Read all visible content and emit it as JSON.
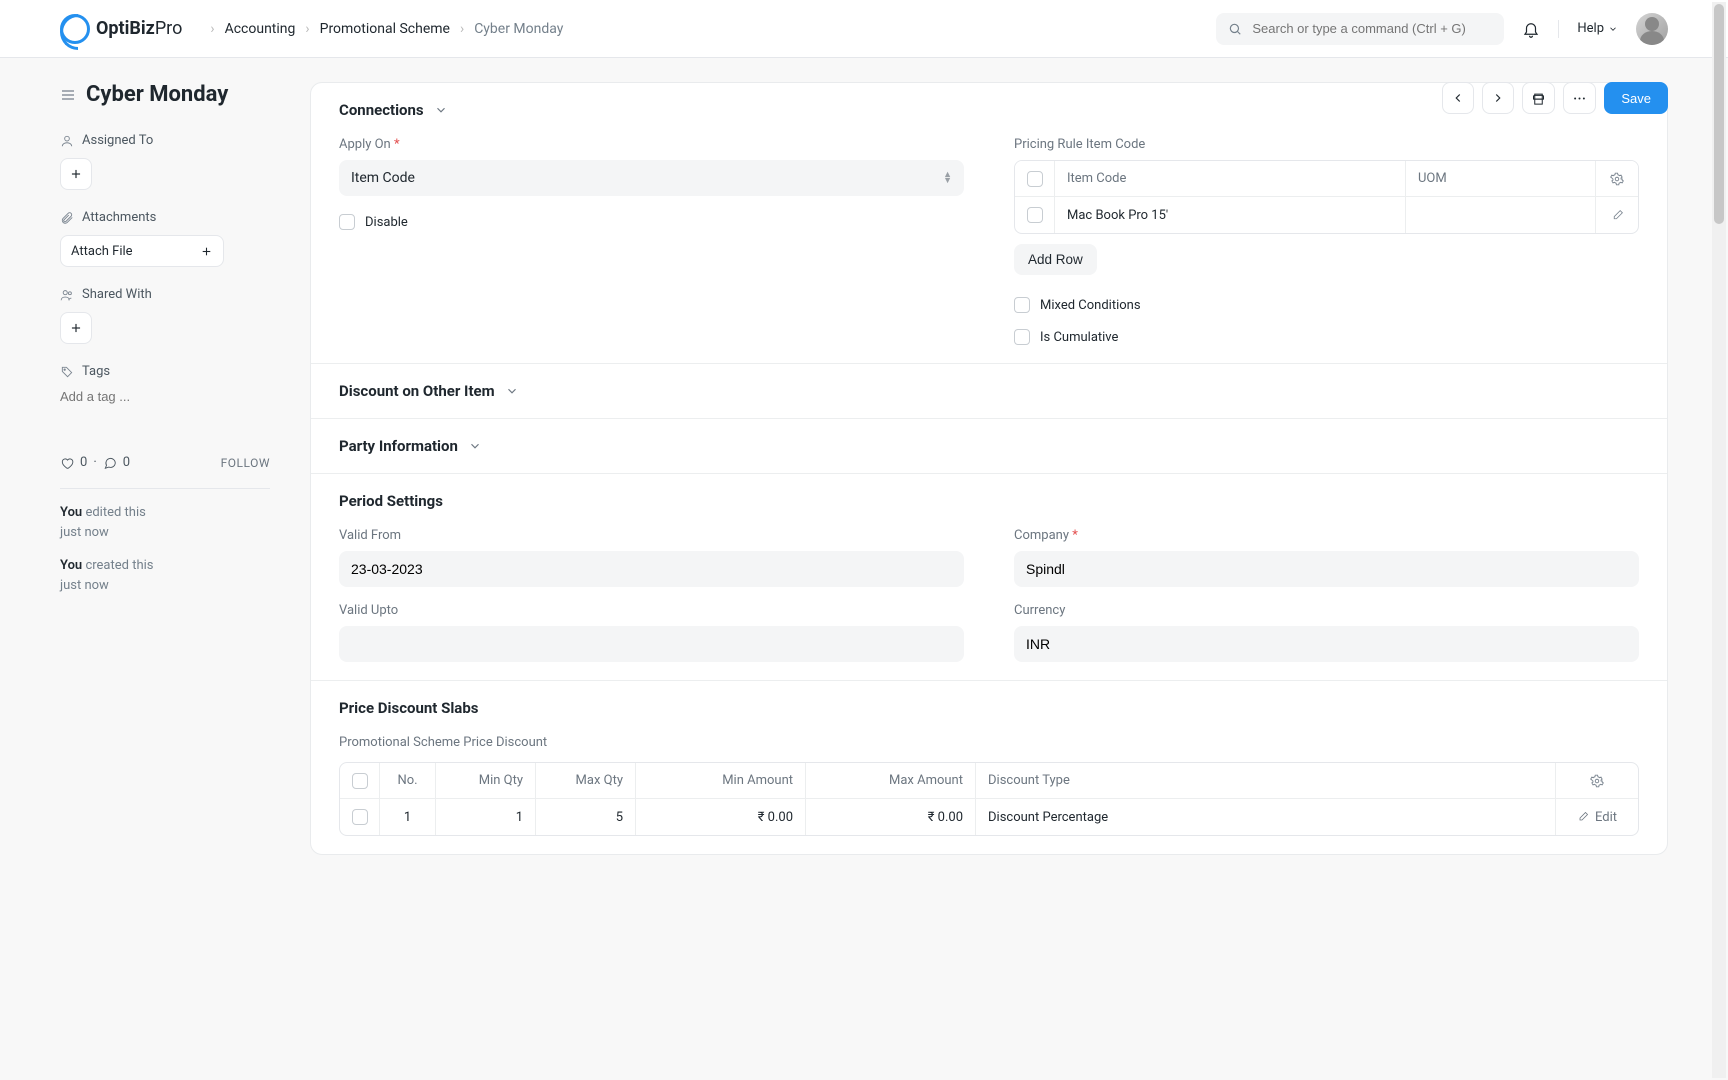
{
  "brand": {
    "name": "OptiBiz",
    "suffix": "Pro"
  },
  "breadcrumb": {
    "root": "Accounting",
    "mid": "Promotional Scheme",
    "leaf": "Cyber Monday"
  },
  "search": {
    "placeholder": "Search or type a command (Ctrl + G)"
  },
  "nav": {
    "help": "Help"
  },
  "page": {
    "title": "Cyber Monday",
    "assigned_to": "Assigned To",
    "attachments": "Attachments",
    "attach_file": "Attach File",
    "shared_with": "Shared With",
    "tags": "Tags",
    "tag_placeholder": "Add a tag ...",
    "likes": "0",
    "comments": "0",
    "follow": "FOLLOW",
    "activity": [
      {
        "who": "You",
        "what": "edited this",
        "when": "just now"
      },
      {
        "who": "You",
        "what": "created this",
        "when": "just now"
      }
    ]
  },
  "toolbar": {
    "save": "Save"
  },
  "sections": {
    "connections": "Connections",
    "discount_other": "Discount on Other Item",
    "party_info": "Party Information",
    "period": "Period Settings",
    "slabs": "Price Discount Slabs"
  },
  "connections": {
    "apply_on_label": "Apply On",
    "apply_on_value": "Item Code",
    "disable": "Disable",
    "pricing_table_title": "Pricing Rule Item Code",
    "item_code_header": "Item Code",
    "uom_header": "UOM",
    "row_item": "Mac Book Pro 15'",
    "add_row": "Add Row",
    "mixed": "Mixed Conditions",
    "cumulative": "Is Cumulative"
  },
  "period": {
    "valid_from_label": "Valid From",
    "valid_from_value": "23-03-2023",
    "valid_upto_label": "Valid Upto",
    "valid_upto_value": "",
    "company_label": "Company",
    "company_value": "Spindl",
    "currency_label": "Currency",
    "currency_value": "INR"
  },
  "slabs": {
    "subtitle": "Promotional Scheme Price Discount",
    "headers": {
      "no": "No.",
      "minq": "Min Qty",
      "maxq": "Max Qty",
      "minamt": "Min Amount",
      "maxamt": "Max Amount",
      "dtype": "Discount Type",
      "edit": "Edit"
    },
    "rows": [
      {
        "no": "1",
        "minq": "1",
        "maxq": "5",
        "minamt": "₹ 0.00",
        "maxamt": "₹ 0.00",
        "dtype": "Discount Percentage"
      }
    ]
  }
}
